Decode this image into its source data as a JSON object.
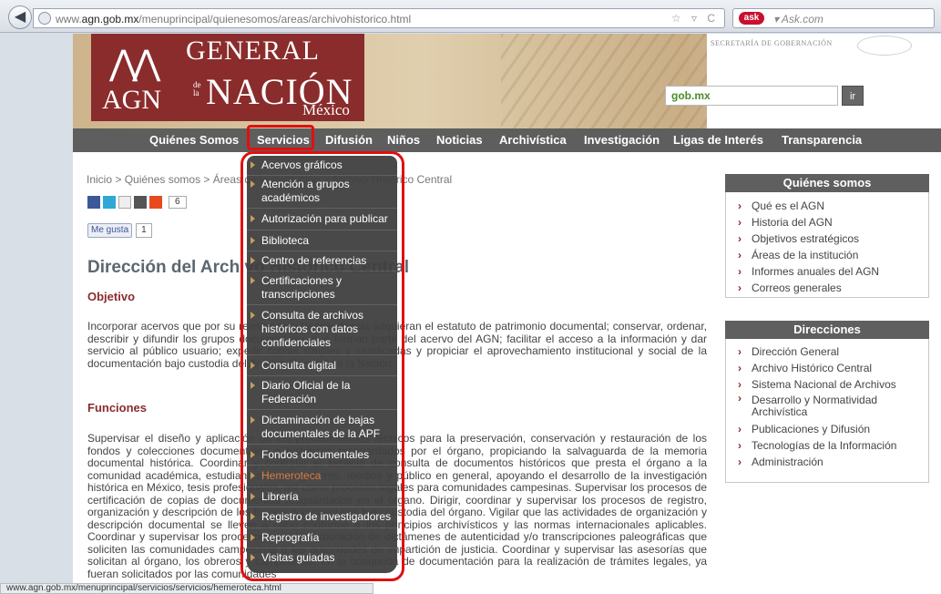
{
  "browser": {
    "back_glyph": "◀",
    "url_prefix": "www.",
    "url_domain": "agn.gob.mx",
    "url_path": "/menuprincipal/quienesomos/areas/archivohistorico.html",
    "url_icons": "☆ ▿ C",
    "search_engine_logo": "ask",
    "search_placeholder": "▾ Ask.com",
    "status_url": "www.agn.gob.mx/menuprincipal/servicios/servicios/hemeroteca.html"
  },
  "header": {
    "logo_symbol": "⋀⋀",
    "logo_letters": "AGN",
    "logo_line1": "GENERAL",
    "logo_dela": "de la",
    "logo_line2": "NACIÓN",
    "logo_line3": "México",
    "segob_text": "SECRETARÍA DE GOBERNACIÓN",
    "gob_logo": "gob.mx",
    "ir_label": "ir"
  },
  "nav": {
    "items": [
      "Quiénes Somos",
      "Servicios",
      "Difusión",
      "Niños",
      "Noticias",
      "Archivística",
      "Investigación",
      "Ligas de Interés",
      "Transparencia"
    ]
  },
  "breadcrumb": "Inicio > Quiénes somos > Áreas de la institución > Archivo Histórico Central",
  "share": {
    "count": "6",
    "like_label": "Me gusta",
    "like_count": "1"
  },
  "page": {
    "title": "Dirección del Archivo Histórico Central",
    "objetivo_heading": "Objetivo",
    "objetivo_text": "Incorporar acervos que por su relevancia y trascendencia adquieran el estatuto de patrimonio documental; conservar, ordenar, describir y difundir los grupos documentales que forman parte del acervo del AGN; facilitar el acceso a la información y dar servicio al público usuario; expedir copias simples y certificadas y propiciar el aprovechamiento institucional y social de la documentación bajo custodia del Archivo General de la Nación.",
    "funciones_heading": "Funciones",
    "funciones_text": "Supervisar el diseño y aplicación de los procedimientos técnicos para la preservación, conservación y restauración de los fondos y colecciones documentales e históricos resguardados por el órgano, propiciando la salvaguarda de la memoria documental histórica. Coordinar y controlar el servicio de consulta de documentos históricos que presta el órgano a la comunidad académica, estudiantes, investigadores, medios y público en general, apoyando el desarrollo de la investigación histórica en México, tesis profesionales, así como procesos legales para comunidades campesinas. Supervisar los procesos de certificación de copias de documentos resguardados en el órgano. Dirigir, coordinar y supervisar los procesos de registro, organización y descripción de los fondos documentales bajo custodia del órgano. Vigilar que las actividades de organización y descripción documental se lleven a cabo conforme a los principios archivísticos y las normas internacionales aplicables. Coordinar y supervisar los procesos para la elaboración de dictámenes de autenticidad y/o transcripciones paleográficas que soliciten las comunidades campesinas o las autoridades de impartición de justicia. Coordinar y supervisar las asesorías que solicitan al órgano, los obreros y campesinos, en la búsqueda de documentación para la realización de trámites legales, ya fueran solicitados por las comunidades"
  },
  "sidebar": {
    "quienes_heading": "Quiénes somos",
    "quienes_items": [
      "Qué es el AGN",
      "Historia del AGN",
      "Objetivos estratégicos",
      "Áreas de la institución",
      "Informes anuales del AGN",
      "Correos generales"
    ],
    "direcciones_heading": "Direcciones",
    "direcciones_items": [
      "Dirección General",
      "Archivo Histórico Central",
      "Sistema Nacional de Archivos",
      "Desarrollo y Normatividad Archivística",
      "Publicaciones y Difusión",
      "Tecnologías de la Información",
      "Administración"
    ]
  },
  "dropdown": {
    "items": [
      "Acervos gráficos",
      "Atención a grupos académicos",
      "Autorización para publicar",
      "Biblioteca",
      "Centro de referencias",
      "Certificaciones y transcripciones",
      "Consulta de archivos históricos con datos confidenciales",
      "Consulta digital",
      "Diario Oficial de la Federación",
      "Dictaminación de bajas documentales de la APF",
      "Fondos documentales",
      "Hemeroteca",
      "Librería",
      "Registro de investigadores",
      "Reprografía",
      "Visitas guiadas"
    ],
    "active": "Hemeroteca"
  },
  "colors": {
    "brand": "#8a2c2c",
    "nav": "#5e5e5e",
    "highlight": "#e01010",
    "active_item": "#e07a3d"
  }
}
